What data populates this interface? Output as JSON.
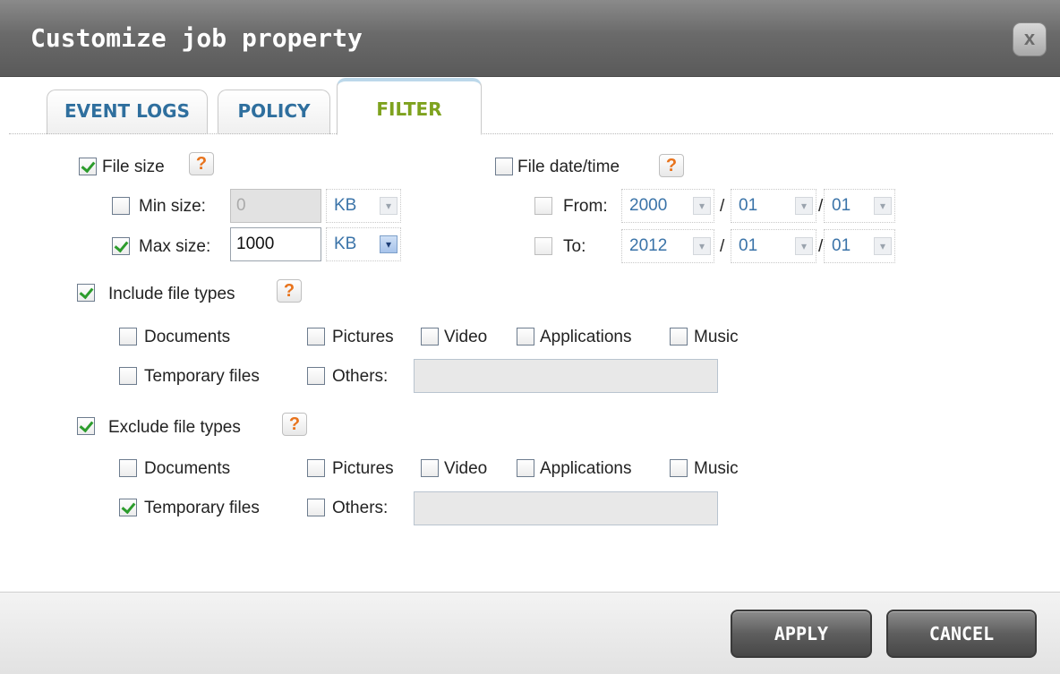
{
  "dialog": {
    "title": "Customize job property",
    "close_label": "x"
  },
  "tabs": [
    {
      "label": "EVENT LOGS",
      "active": false
    },
    {
      "label": "POLICY",
      "active": false
    },
    {
      "label": "FILTER",
      "active": true
    }
  ],
  "file_size": {
    "label": "File size",
    "checked": true,
    "min": {
      "label": "Min size:",
      "checked": false,
      "value": "0",
      "unit": "KB"
    },
    "max": {
      "label": "Max size:",
      "checked": true,
      "value": "1000",
      "unit": "KB"
    }
  },
  "file_date": {
    "label": "File date/time",
    "checked": false,
    "from": {
      "label": "From:",
      "checked": false,
      "year": "2000",
      "month": "01",
      "day": "01"
    },
    "to": {
      "label": "To:",
      "checked": false,
      "year": "2012",
      "month": "01",
      "day": "01"
    },
    "separator": "/"
  },
  "include": {
    "label": "Include file types",
    "checked": true,
    "types": {
      "documents": {
        "label": "Documents",
        "checked": false
      },
      "pictures": {
        "label": "Pictures",
        "checked": false
      },
      "video": {
        "label": "Video",
        "checked": false
      },
      "applications": {
        "label": "Applications",
        "checked": false
      },
      "music": {
        "label": "Music",
        "checked": false
      },
      "temporary": {
        "label": "Temporary files",
        "checked": false
      },
      "others": {
        "label": "Others:",
        "checked": false,
        "value": ""
      }
    }
  },
  "exclude": {
    "label": "Exclude file types",
    "checked": true,
    "types": {
      "documents": {
        "label": "Documents",
        "checked": false
      },
      "pictures": {
        "label": "Pictures",
        "checked": false
      },
      "video": {
        "label": "Video",
        "checked": false
      },
      "applications": {
        "label": "Applications",
        "checked": false
      },
      "music": {
        "label": "Music",
        "checked": false
      },
      "temporary": {
        "label": "Temporary files",
        "checked": true
      },
      "others": {
        "label": "Others:",
        "checked": false,
        "value": ""
      }
    }
  },
  "help_label": "?",
  "buttons": {
    "apply": "APPLY",
    "cancel": "CANCEL"
  },
  "colors": {
    "titlebar": "#6a6a6a",
    "tab_text": "#2f6f9e",
    "active_tab_text": "#7ea21e",
    "check": "#2c9c2c",
    "help": "#e8731c"
  },
  "icons": {
    "help": "help-icon",
    "close": "close-icon",
    "dropdown": "chevron-down-icon"
  }
}
